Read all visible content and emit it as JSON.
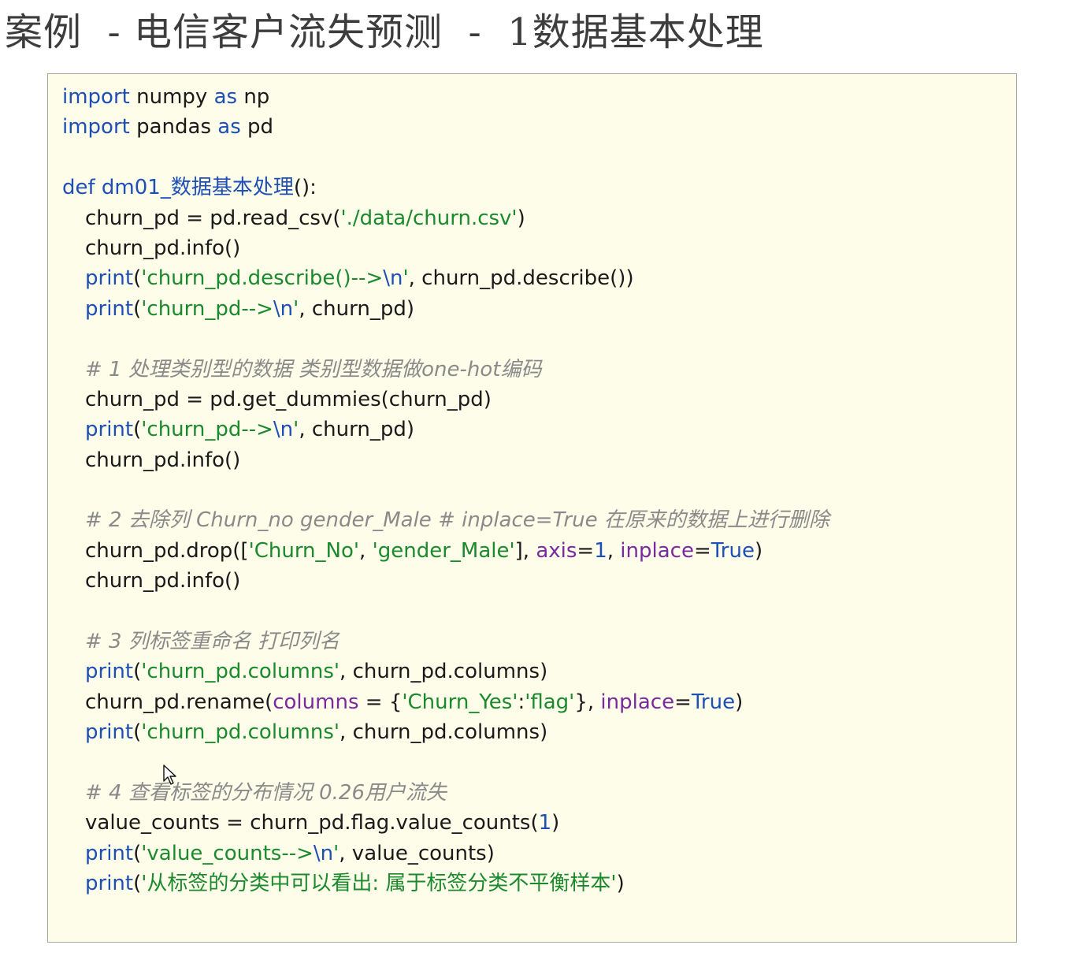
{
  "title": "案例  - 电信客户流失预测  -  1数据基本处理",
  "code": {
    "import": "import",
    "as": "as",
    "def": "def",
    "numpy": " numpy ",
    "np": " np",
    "pandas": " pandas ",
    "pd": " pd",
    "func_name": " dm01_数据基本处理",
    "func_tail": "():",
    "l3_a": "churn_pd = pd.read_csv(",
    "l3_str": "'./data/churn.csv'",
    "l3_b": ")",
    "l4": "churn_pd.info()",
    "print": "print",
    "l5_open": "(",
    "l5_str1": "'churn_pd.describe()-->",
    "l5_esc": "\\n",
    "l5_str2": "'",
    "l5_rest": ", churn_pd.describe())",
    "l6_str1": "'churn_pd-->",
    "l6_esc": "\\n",
    "l6_str2": "'",
    "l6_rest": ", churn_pd)",
    "c1": "# 1 处理类别型的数据 类别型数据做one-hot编码",
    "l8": "churn_pd = pd.get_dummies(churn_pd)",
    "c2": "# 2 去除列 Churn_no gender_Male # inplace=True 在原来的数据上进行删除",
    "l12_a": "churn_pd.drop([",
    "l12_s1": "'Churn_No'",
    "l12_sep": ", ",
    "l12_s2": "'gender_Male'",
    "l12_b": "], ",
    "axis": "axis",
    "eq": "=",
    "one": "1",
    "comma": ", ",
    "inplace": "inplace",
    "true": "True",
    "close": ")",
    "c3": "# 3 列标签重命名 打印列名",
    "cols_str": "'churn_pd.columns'",
    "cols_rest": ", churn_pd.columns)",
    "l16_a": "churn_pd.rename(",
    "columns_kw": "columns",
    "l16_eq": " = {",
    "l16_s1": "'Churn_Yes'",
    "colon": ":",
    "l16_s2": "'flag'",
    "l16_b": "}, ",
    "c4": "# 4 查看标签的分布情况 0.26用户流失",
    "l19_a": "value_counts = churn_pd.flag.value_counts(",
    "l20_str1": "'value_counts-->",
    "l20_esc": "\\n",
    "l20_str2": "'",
    "l20_rest": ", value_counts)",
    "l21_str": "'从标签的分类中可以看出: 属于标签分类不平衡样本'"
  }
}
